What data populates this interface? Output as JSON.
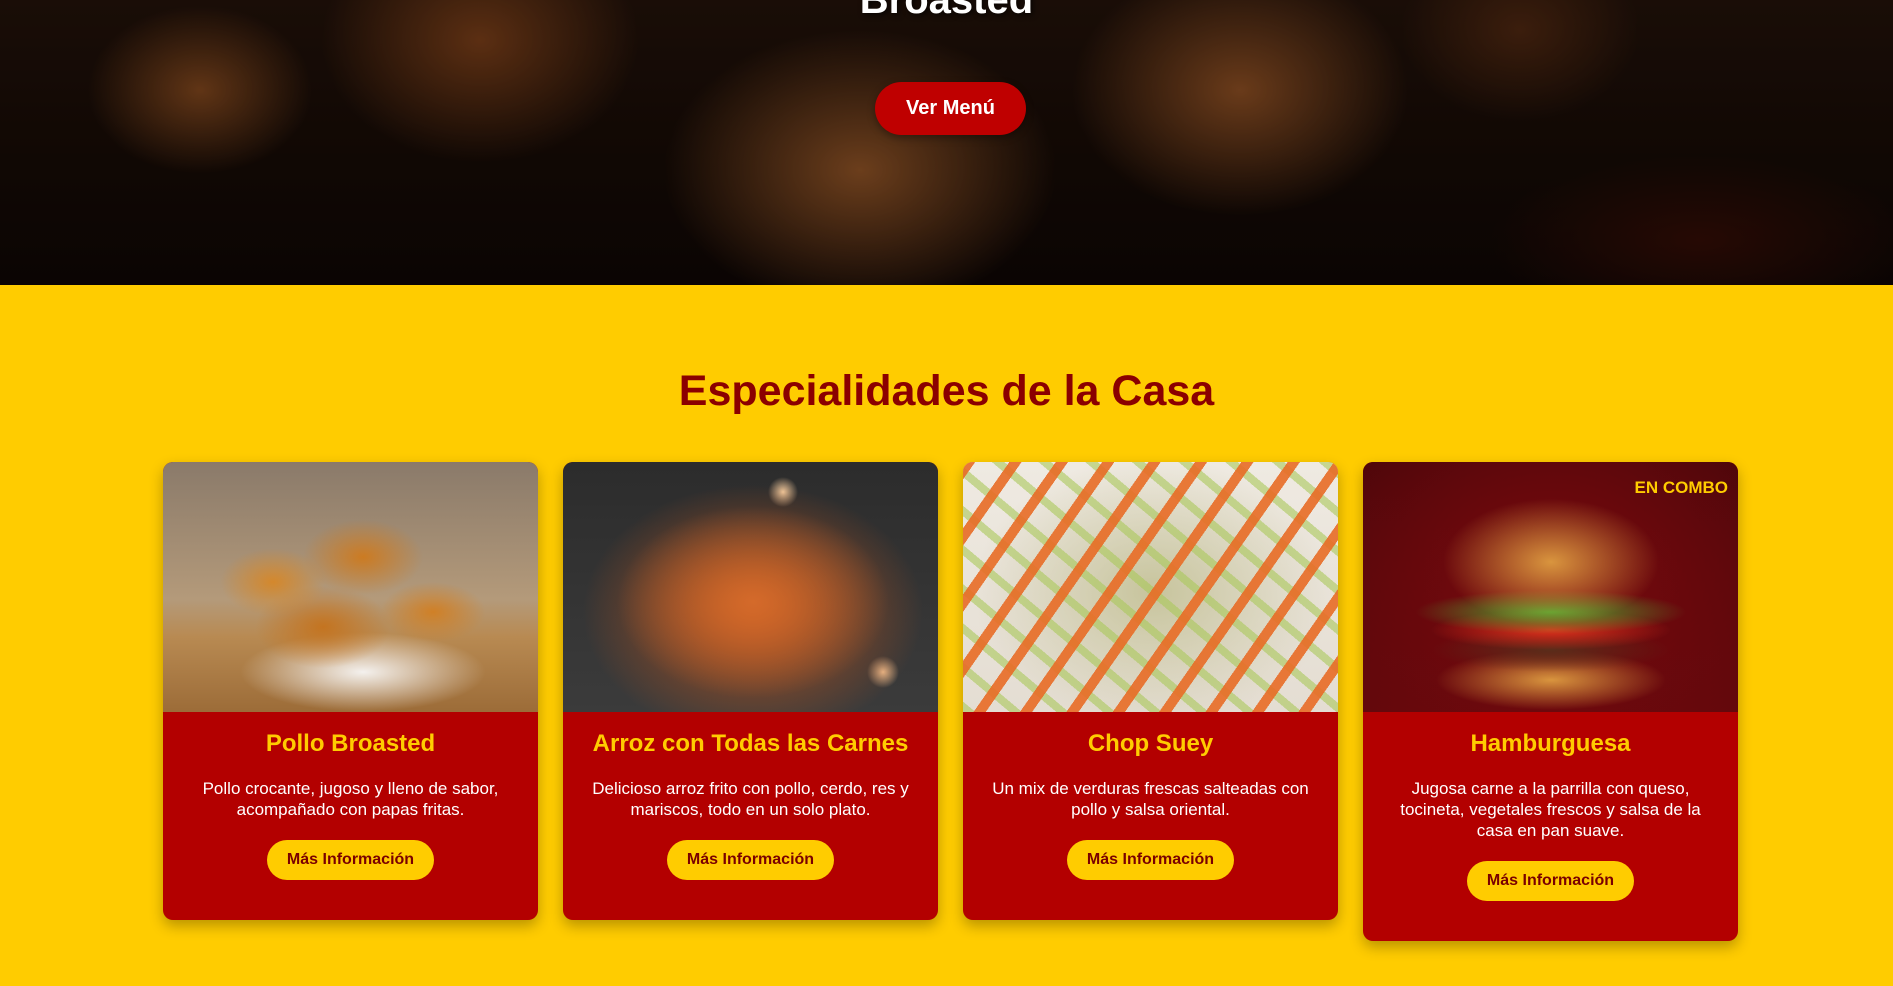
{
  "hero": {
    "title": "Broasted",
    "button_label": "Ver Menú"
  },
  "specials": {
    "title": "Especialidades de la Casa",
    "items": [
      {
        "name": "Pollo Broasted",
        "description": "Pollo crocante, jugoso y lleno de sabor, acompañado con papas fritas.",
        "button_label": "Más Información"
      },
      {
        "name": "Arroz con Todas las Carnes",
        "description": "Delicioso arroz frito con pollo, cerdo, res y mariscos, todo en un solo plato.",
        "button_label": "Más Información"
      },
      {
        "name": "Chop Suey",
        "description": "Un mix de verduras frescas salteadas con pollo y salsa oriental.",
        "button_label": "Más Información"
      },
      {
        "name": "Hamburguesa",
        "description": "Jugosa carne a la parrilla con queso, tocineta, vegetales frescos y salsa de la casa en pan suave.",
        "button_label": "Más Información",
        "image_tag": "EN COMBO"
      }
    ]
  },
  "colors": {
    "background": "#ffcc00",
    "card": "#b30000",
    "title": "#8b0000",
    "accent": "#ffcc00",
    "hero_button": "#bf0000"
  }
}
